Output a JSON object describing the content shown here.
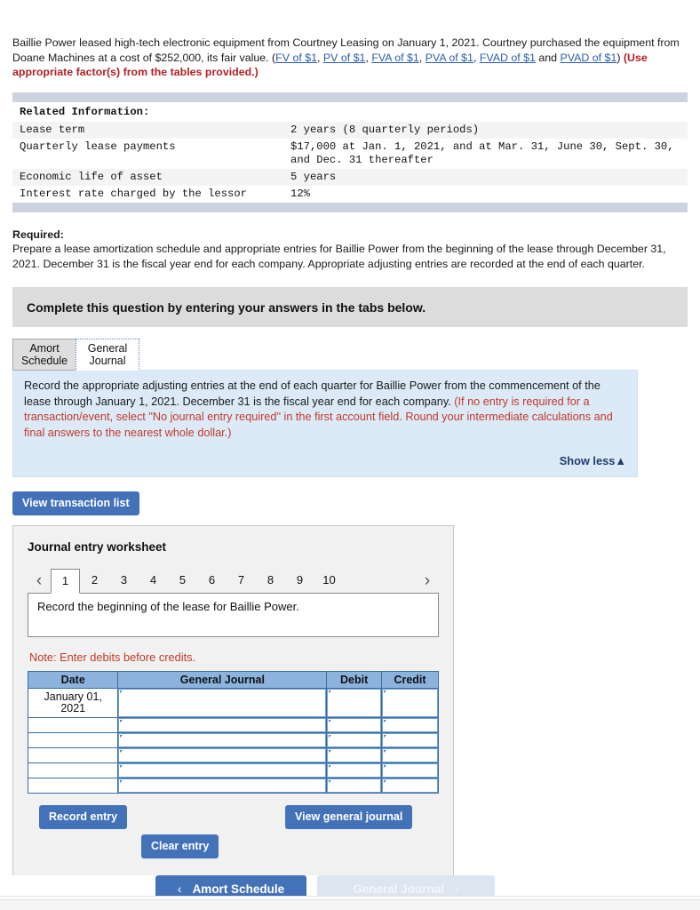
{
  "stem": {
    "part1": "Baillie Power leased high-tech electronic equipment from Courtney Leasing on January 1, 2021. Courtney purchased the equipment from Doane Machines at a cost of $252,000, its fair value. (",
    "links": [
      "FV of $1",
      "PV of $1",
      "FVA of $1",
      "PVA of $1",
      "FVAD of $1",
      "PVAD of $1"
    ],
    "and_word": " and ",
    "close_paren": ") ",
    "red_note": "(Use appropriate factor(s) from the tables provided.)"
  },
  "related": {
    "heading": "Related Information:",
    "rows": [
      {
        "label": "Lease term",
        "value": "2 years (8 quarterly periods)"
      },
      {
        "label": "Quarterly lease payments",
        "value": "$17,000 at Jan. 1, 2021, and at Mar. 31, June 30, Sept. 30, and Dec. 31 thereafter"
      },
      {
        "label": "Economic life of asset",
        "value": "5 years"
      },
      {
        "label": "Interest rate charged by the lessor",
        "value": "12%"
      }
    ]
  },
  "required": {
    "heading": "Required:",
    "text": "Prepare a lease amortization schedule and appropriate entries for Baillie Power from the beginning of the lease through December 31, 2021. December 31 is the fiscal year end for each company. Appropriate adjusting entries are recorded at the end of each quarter."
  },
  "banner": {
    "text": "Complete this question by entering your answers in the tabs below."
  },
  "tabs": [
    {
      "line1": "Amort",
      "line2": "Schedule",
      "active": false
    },
    {
      "line1": "General",
      "line2": "Journal",
      "active": true
    }
  ],
  "instructions": {
    "black": "Record the appropriate adjusting  entries at the end of each quarter for Baillie Power from the commencement of the lease through January 1, 2021. December 31 is the fiscal year end for each company. ",
    "red": "(If no entry is required for a transaction/event, select \"No journal entry required\" in the first account field. Round your intermediate calculations and final answers to the nearest whole dollar.)",
    "show_less": "Show less▲"
  },
  "view_transaction_list": "View transaction list",
  "worksheet": {
    "title": "Journal entry worksheet",
    "prev_arrow": "‹",
    "next_arrow": "›",
    "pages": [
      "1",
      "2",
      "3",
      "4",
      "5",
      "6",
      "7",
      "8",
      "9",
      "10"
    ],
    "active_page": "1",
    "description": "Record the beginning of the lease for Baillie Power.",
    "note": "Note: Enter debits before credits.",
    "table": {
      "headers": [
        "Date",
        "General Journal",
        "Debit",
        "Credit"
      ],
      "rows": [
        {
          "date": "January 01, 2021",
          "general_journal": "",
          "debit": "",
          "credit": ""
        },
        {
          "date": "",
          "general_journal": "",
          "debit": "",
          "credit": ""
        },
        {
          "date": "",
          "general_journal": "",
          "debit": "",
          "credit": ""
        },
        {
          "date": "",
          "general_journal": "",
          "debit": "",
          "credit": ""
        },
        {
          "date": "",
          "general_journal": "",
          "debit": "",
          "credit": ""
        },
        {
          "date": "",
          "general_journal": "",
          "debit": "",
          "credit": ""
        }
      ]
    },
    "buttons": {
      "record_entry": "Record entry",
      "clear_entry": "Clear entry",
      "view_general_journal": "View general journal"
    }
  },
  "bottom_nav": {
    "prev_chevron": "‹",
    "prev_label": "Amort Schedule",
    "next_label": "General Journal",
    "next_chevron": "›"
  },
  "colors": {
    "accent_blue": "#4472b8",
    "panel_blue": "#dceaf7",
    "table_header_blue": "#8cb3dd",
    "link_blue": "#2a5db0",
    "red": "#c0392b",
    "banner_gray": "#dcdcdc"
  }
}
